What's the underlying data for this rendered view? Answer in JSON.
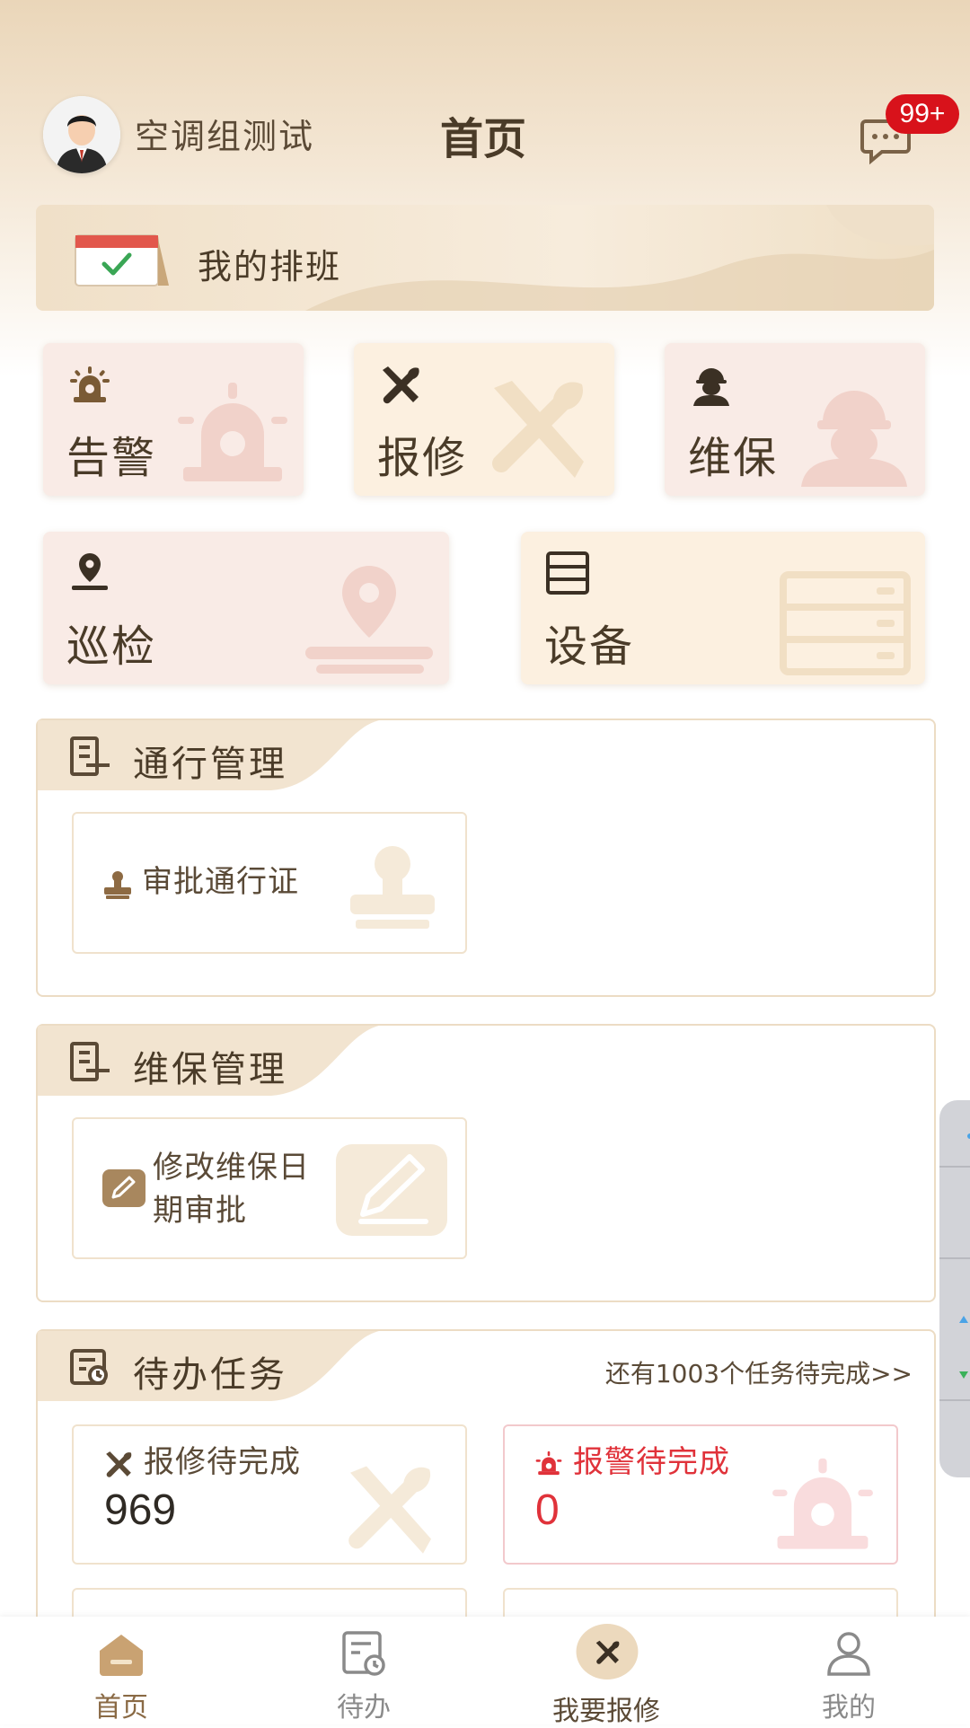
{
  "header": {
    "user_name": "空调组测试",
    "title": "首页",
    "message_badge": "99+"
  },
  "schedule": {
    "label": "我的排班"
  },
  "quick_tiles": [
    {
      "label": "告警",
      "icon": "alarm-icon"
    },
    {
      "label": "报修",
      "icon": "tools-icon"
    },
    {
      "label": "维保",
      "icon": "worker-icon"
    },
    {
      "label": "巡检",
      "icon": "location-pin-icon"
    },
    {
      "label": "设备",
      "icon": "server-icon"
    }
  ],
  "sections": {
    "pass_management": {
      "title": "通行管理",
      "items": [
        {
          "label": "审批通行证"
        }
      ]
    },
    "maintenance_management": {
      "title": "维保管理",
      "items": [
        {
          "label": "修改维保日期审批"
        }
      ]
    },
    "todo": {
      "title": "待办任务",
      "more_text": "还有1003个任务待完成>>",
      "cards": [
        {
          "label": "报修待完成",
          "count": "969",
          "color": "#4a3b28"
        },
        {
          "label": "报警待完成",
          "count": "0",
          "color": "#e0323a"
        }
      ]
    }
  },
  "bottom_nav": [
    {
      "label": "首页",
      "icon": "home-icon",
      "active": true
    },
    {
      "label": "待办",
      "icon": "todo-icon",
      "active": false
    },
    {
      "label": "我要报修",
      "icon": "repair-icon",
      "active": false
    },
    {
      "label": "我的",
      "icon": "user-icon",
      "active": false
    }
  ],
  "colors": {
    "accent": "#b9915f",
    "alarm_red": "#e0323a",
    "badge_red": "#d8121b"
  }
}
